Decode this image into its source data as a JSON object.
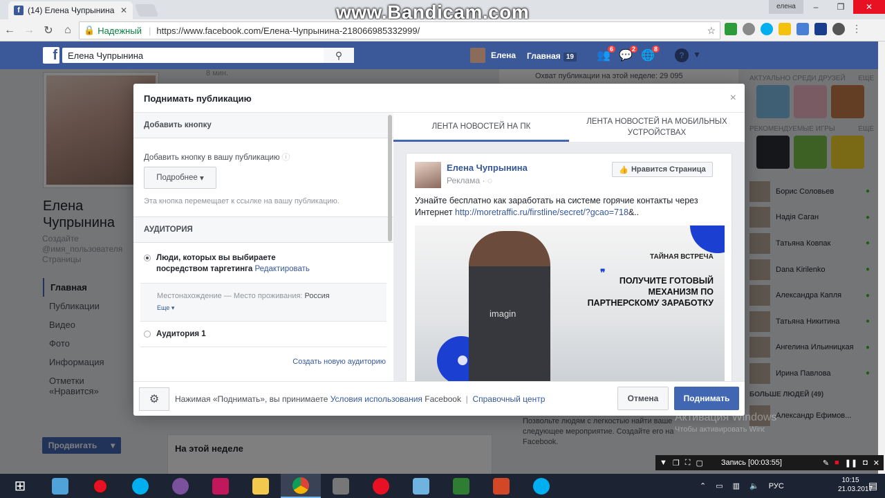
{
  "browser": {
    "tab_title": "(14) Елена Чупрынина",
    "tab_close": "✕",
    "window_user": "елена",
    "secure_label": "Надежный",
    "url": "https://www.facebook.com/Елена-Чупрынина-218066985332999/",
    "watermark": "www.Bandicam.com"
  },
  "fb_header": {
    "search_value": "Елена Чупрынина",
    "user_name": "Елена",
    "home_label": "Главная",
    "home_count": "19",
    "friend_requests": "6",
    "messages": "2",
    "notifications": "8",
    "help": "?"
  },
  "profile": {
    "name": "Елена Чупрынина",
    "subtitle": "Создайте @имя_пользователя Страницы",
    "nav": [
      "Главная",
      "Публикации",
      "Видео",
      "Фото",
      "Информация",
      "Отметки «Нравится»"
    ],
    "promote_label": "Продвигать"
  },
  "background": {
    "top_time": "8 мин.",
    "reach": "Охват публикации на этой неделе: 29 095",
    "this_week": "На этой неделе",
    "event_text": "Позвольте людям с легкостью найти ваше следующее мероприятие. Создайте его на Facebook."
  },
  "sidebar": {
    "trending_title": "АКТУАЛЬНО СРЕДИ ДРУЗЕЙ",
    "trending_more": "ЕЩЕ",
    "games_title": "РЕКОМЕНДУЕМЫЕ ИГРЫ",
    "games_more": "ЕЩЕ",
    "friends": [
      "Борис Соловьев",
      "Надія Саган",
      "Татьяна Ковпак",
      "Dana Kirilenko",
      "Александра Капля",
      "Татьяна Никитина",
      "Ангелина Ильиницкая",
      "Ирина Павлова"
    ],
    "more_people": "БОЛЬШЕ ЛЮДЕЙ (49)",
    "last_friend": "Александр Ефимов..."
  },
  "modal": {
    "title": "Поднимать публикацию",
    "close": "×",
    "add_button_header": "Добавить кнопку",
    "add_button_label": "Добавить кнопку в вашу публикацию",
    "dropdown_value": "Подробнее",
    "button_hint": "Эта кнопка перемещает к ссылке на вашу публикацию.",
    "audience_header": "АУДИТОРИЯ",
    "audience_option1": "Люди, которых вы выбираете посредством таргетинга",
    "edit_link": "Редактировать",
    "location_label": "Местонахождение — Место проживания:",
    "location_value": "Россия",
    "more_link": "Еще",
    "audience_option2": "Аудитория 1",
    "create_audience": "Создать новую аудиторию",
    "tab_desktop": "ЛЕНТА НОВОСТЕЙ НА ПК",
    "tab_mobile": "ЛЕНТА НОВОСТЕЙ НА МОБИЛЬНЫХ УСТРОЙСТВАХ",
    "footer_text_pre": "Нажимая «Поднимать», вы принимаете",
    "terms_link": "Условия использования",
    "footer_fb": "Facebook",
    "footer_sep": "|",
    "help_center": "Справочный центр",
    "cancel": "Отмена",
    "boost": "Поднимать"
  },
  "preview_post": {
    "page_name": "Елена Чупрынина",
    "sponsored": "Реклама",
    "like_page": "Нравится Страница",
    "text": "Узнайте бесплатно как заработать на системе горячие контакты через Интернет",
    "link": "http://moretraffic.ru/firstline/secret/?gcao=718",
    "link_suffix": "&..",
    "ad_tag": "ТАЙНАЯ ВСТРЕЧА",
    "ad_headline": "ПОЛУЧИТЕ ГОТОВЫЙ МЕХАНИЗМ ПО ПАРТНЕРСКОМУ ЗАРАБОТКУ",
    "shirt_text": "imagin"
  },
  "overlays": {
    "windows_watermark_1": "Активация Windows",
    "windows_watermark_2": "Чтобы активировать Windows, перейдите в раздел параметров компьютера.",
    "recording": "Запись [00:03:55]"
  },
  "taskbar": {
    "lang": "РУС",
    "time": "10:15",
    "date": "21.03.2017"
  },
  "colors": {
    "fb_blue": "#3b5998",
    "button_blue": "#4267b2",
    "link_blue": "#365899",
    "ad_blue": "#1a3fd1"
  }
}
